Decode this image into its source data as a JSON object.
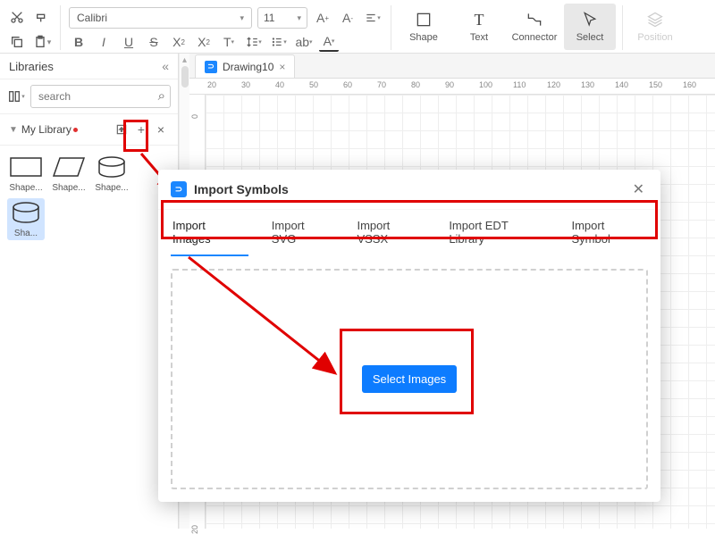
{
  "toolbar": {
    "font": "Calibri",
    "size": "11",
    "tools": {
      "shape": "Shape",
      "text": "Text",
      "connector": "Connector",
      "select": "Select",
      "position": "Position"
    }
  },
  "sidebar": {
    "title": "Libraries",
    "search_placeholder": "search",
    "lib_name": "My Library",
    "shapes": [
      "Shape...",
      "Shape...",
      "Shape...",
      "Sha..."
    ]
  },
  "tab_name": "Drawing10",
  "ruler": [
    "20",
    "30",
    "40",
    "50",
    "60",
    "70",
    "80",
    "90",
    "100",
    "110",
    "120",
    "130",
    "140",
    "150",
    "160"
  ],
  "ruler_v": [
    "0",
    "20"
  ],
  "dialog": {
    "title": "Import Symbols",
    "tabs": [
      "Import Images",
      "Import SVG",
      "Import VSSX",
      "Import EDT Library",
      "Import Symbol"
    ],
    "button": "Select Images"
  }
}
